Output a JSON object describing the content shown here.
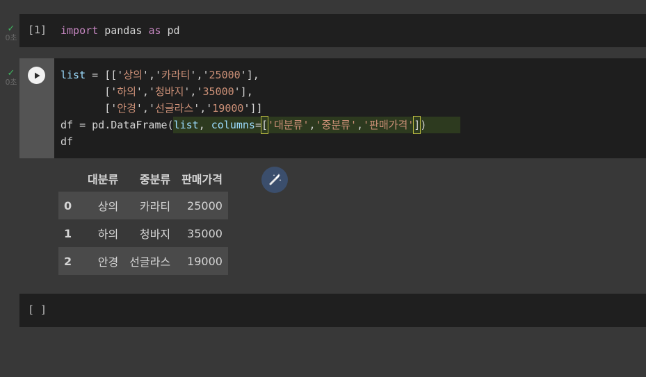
{
  "cells": [
    {
      "status_time": "0초",
      "exec_count": "[1]",
      "code": {
        "kw_import": "import",
        "module": "pandas",
        "kw_as": "as",
        "alias": "pd"
      }
    },
    {
      "status_time": "0초",
      "code_lines": [
        [
          "list",
          " = [['",
          "상의",
          "','",
          "카라티",
          "','",
          "25000",
          "'],"
        ],
        [
          "       ['",
          "하의",
          "','",
          "청바지",
          "','",
          "35000",
          "'],"
        ],
        [
          "       ['",
          "안경",
          "','",
          "선글라스",
          "','",
          "19000",
          "']]"
        ]
      ],
      "line4": {
        "lhs": "df = pd.DataFrame(",
        "arg1": "list",
        "sep": ", ",
        "kw": "columns",
        "eq": "=",
        "open": "[",
        "c1": "'대분류'",
        "c2": "'중분류'",
        "c3": "'판매가격'",
        "close": "]",
        "end": ")"
      },
      "line5": "df",
      "output_table": {
        "columns": [
          "대분류",
          "중분류",
          "판매가격"
        ],
        "rows": [
          {
            "index": "0",
            "values": [
              "상의",
              "카라티",
              "25000"
            ]
          },
          {
            "index": "1",
            "values": [
              "하의",
              "청바지",
              "35000"
            ]
          },
          {
            "index": "2",
            "values": [
              "안경",
              "선글라스",
              "19000"
            ]
          }
        ]
      }
    },
    {
      "exec_count": "[ ]"
    }
  ],
  "colors": {
    "check": "#3fb55f",
    "keyword": "#c586c0",
    "string": "#ce9178",
    "variable": "#9cdcfe",
    "wand_bg": "#3b4e6c"
  }
}
